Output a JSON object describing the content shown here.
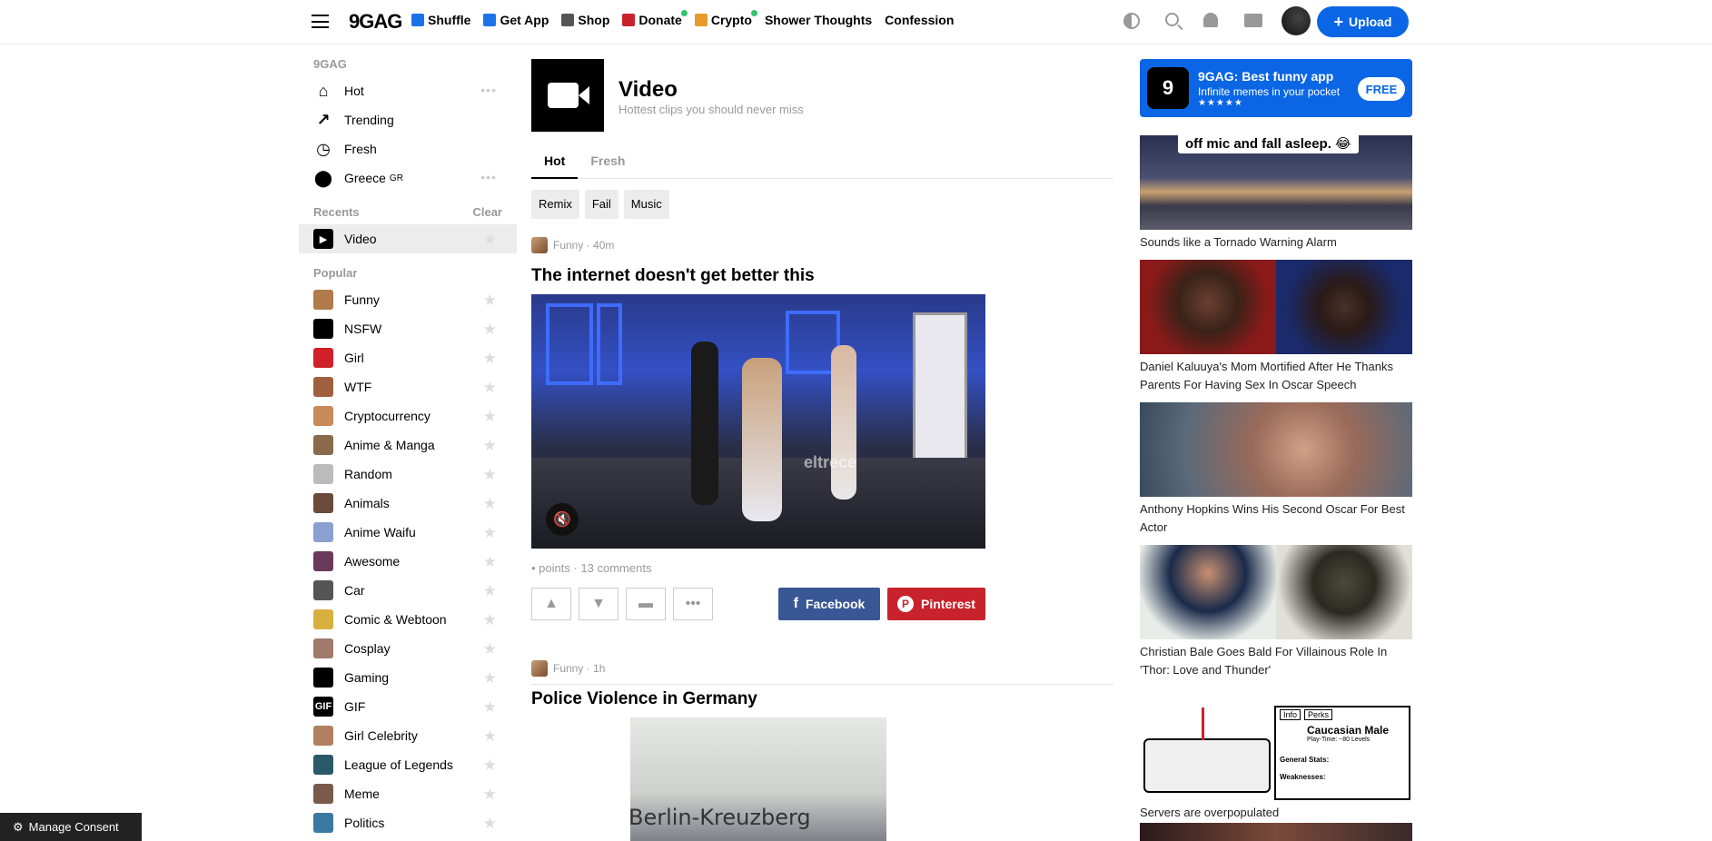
{
  "header": {
    "logo": "9GAG",
    "nav": [
      {
        "label": "Shuffle",
        "icon": "shuffle-icon",
        "color": "#1a73e8"
      },
      {
        "label": "Get App",
        "icon": "phone-icon",
        "color": "#1a73e8"
      },
      {
        "label": "Shop",
        "icon": "cart-icon",
        "color": "#555555"
      },
      {
        "label": "Donate",
        "icon": "age-18-icon",
        "color": "#c8232c",
        "dot": true
      },
      {
        "label": "Crypto",
        "icon": "cat-icon",
        "color": "#e89a2c",
        "dot": true
      },
      {
        "label": "Shower Thoughts",
        "icon": "",
        "color": ""
      },
      {
        "label": "Confession",
        "icon": "",
        "color": ""
      }
    ],
    "upload_label": "Upload"
  },
  "sidebar": {
    "section_label": "9GAG",
    "main_items": [
      {
        "label": "Hot",
        "icon": "home-icon"
      },
      {
        "label": "Trending",
        "icon": "trending-icon"
      },
      {
        "label": "Fresh",
        "icon": "clock-icon"
      },
      {
        "label": "Greece",
        "suffix": "GR",
        "icon": "location-icon"
      }
    ],
    "recents_label": "Recents",
    "clear_label": "Clear",
    "recents": [
      {
        "label": "Video",
        "icon": "video-icon"
      }
    ],
    "popular_label": "Popular",
    "popular": [
      {
        "label": "Funny",
        "color": "#b07a4a"
      },
      {
        "label": "NSFW",
        "color": "#000000"
      },
      {
        "label": "Girl",
        "color": "#d0202a"
      },
      {
        "label": "WTF",
        "color": "#a06040"
      },
      {
        "label": "Cryptocurrency",
        "color": "#c88a5a"
      },
      {
        "label": "Anime & Manga",
        "color": "#8a6a4a"
      },
      {
        "label": "Random",
        "color": "#bbbbbb"
      },
      {
        "label": "Animals",
        "color": "#6a4a3a"
      },
      {
        "label": "Anime Waifu",
        "color": "#8aa0d0"
      },
      {
        "label": "Awesome",
        "color": "#6a3a5a"
      },
      {
        "label": "Car",
        "color": "#555555"
      },
      {
        "label": "Comic & Webtoon",
        "color": "#d8b040"
      },
      {
        "label": "Cosplay",
        "color": "#a07a6a"
      },
      {
        "label": "Gaming",
        "color": "#000000"
      },
      {
        "label": "GIF",
        "color": "#000000",
        "text": "GIF"
      },
      {
        "label": "Girl Celebrity",
        "color": "#b08060"
      },
      {
        "label": "League of Legends",
        "color": "#2a5a6a"
      },
      {
        "label": "Meme",
        "color": "#7a5a4a"
      },
      {
        "label": "Politics",
        "color": "#3a7aa0"
      }
    ]
  },
  "section": {
    "title": "Video",
    "subtitle": "Hottest clips you should never miss",
    "tabs": [
      "Hot",
      "Fresh"
    ],
    "chips": [
      "Remix",
      "Fail",
      "Music"
    ]
  },
  "posts": [
    {
      "category": "Funny · 40m",
      "title": "The internet doesn't get better this",
      "stats": "• points · 13 comments",
      "facebook_label": "Facebook",
      "pinterest_label": "Pinterest",
      "watermark": "eltrece"
    },
    {
      "category": "Funny · 1h",
      "title": "Police Violence in Germany",
      "image_text": "Berlin-Kreuzberg"
    }
  ],
  "right": {
    "ad": {
      "logo": "9",
      "title": "9GAG: Best funny app",
      "subtitle": "Infinite memes in your pocket",
      "stars": "★★★★★",
      "cta": "FREE"
    },
    "cards": [
      {
        "caption": "Sounds like a Tornado Warning Alarm",
        "overlay": "off mic and fall asleep. 😂"
      },
      {
        "caption": "Daniel Kaluuya's Mom Mortified After He Thanks Parents For Having Sex In Oscar Speech"
      },
      {
        "caption": "Anthony Hopkins Wins His Second Oscar For Best Actor"
      },
      {
        "caption": "Christian Bale Goes Bald For Villainous Role In 'Thor: Love and Thunder'"
      },
      {
        "caption": "Servers are overpopulated",
        "comic_tabs": [
          "Info",
          "Perks"
        ],
        "comic_title": "Caucasian Male",
        "comic_sub": "Play-Time: ~80 Levels",
        "comic_stats": "General Stats:",
        "comic_weak": "Weaknesses:"
      }
    ]
  },
  "consent_label": "Manage Consent"
}
